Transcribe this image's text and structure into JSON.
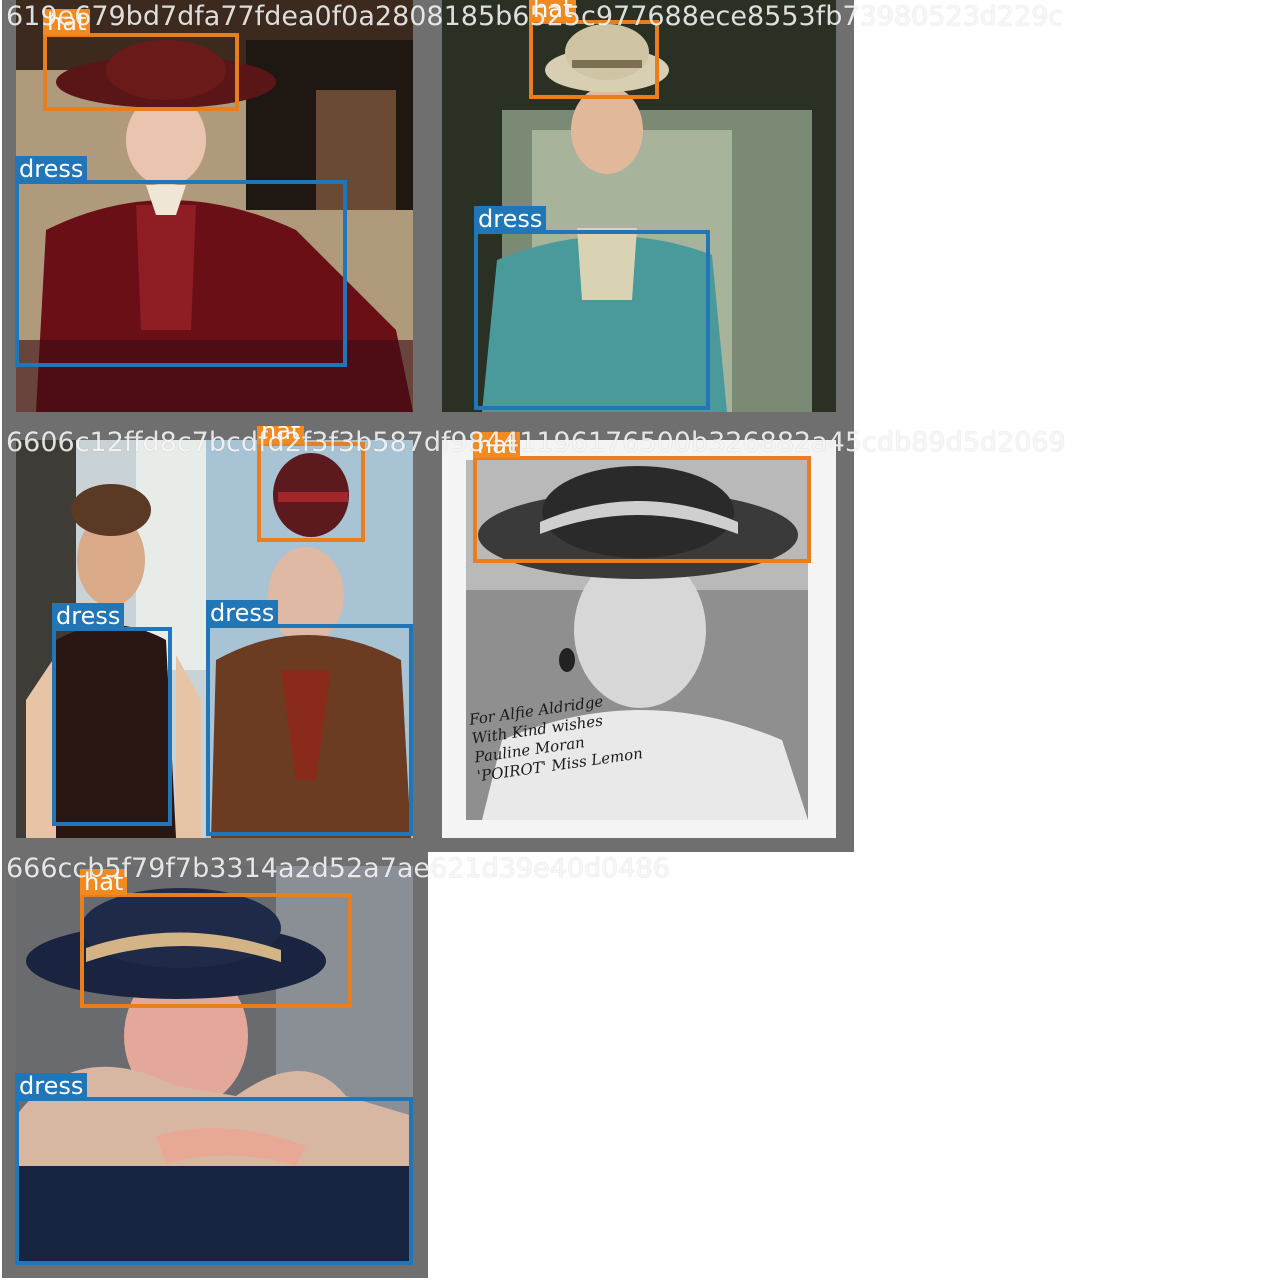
{
  "tiles": [
    {
      "caption": "619e679bd7dfa77fdea0f0a2808185b6525c977688ece8553fb73980523d229c",
      "boxes": [
        {
          "label": "hat"
        },
        {
          "label": "dress"
        }
      ]
    },
    {
      "boxes": [
        {
          "label": "hat"
        },
        {
          "label": "dress"
        }
      ]
    },
    {
      "caption": "6606c12ffd8c7bcdfd2f3f3b587df98441196176500b326882a45cdb89d5d2069",
      "boxes": [
        {
          "label": "hat"
        },
        {
          "label": "dress"
        },
        {
          "label": "dress"
        }
      ]
    },
    {
      "boxes": [
        {
          "label": "hat"
        }
      ],
      "signature": [
        "For Alfie Aldridge",
        "With Kind wishes",
        "Pauline Moran",
        "'POIROT' Miss Lemon"
      ]
    },
    {
      "caption": "666ccb5f79f7b3314a2d52a7ae621d39e40d0486",
      "boxes": [
        {
          "label": "hat"
        },
        {
          "label": "dress"
        }
      ]
    }
  ]
}
